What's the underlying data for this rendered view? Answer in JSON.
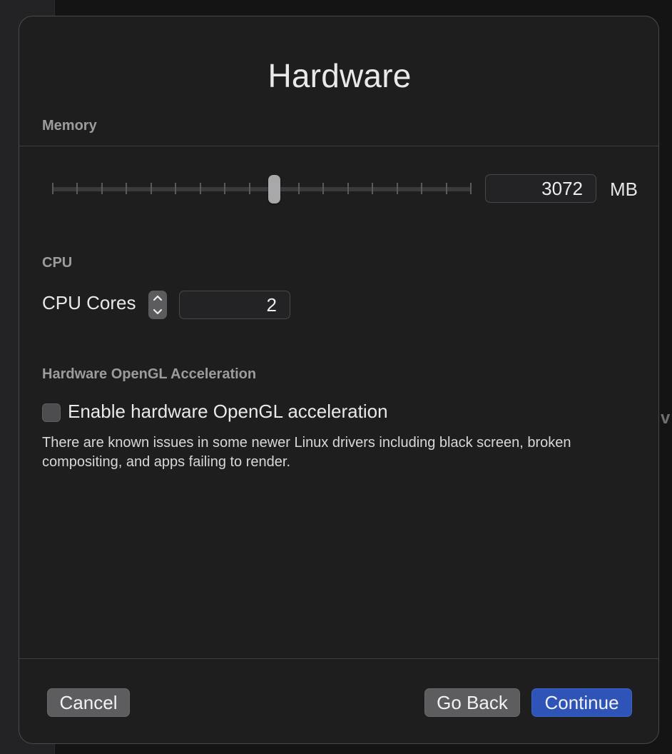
{
  "window": {
    "title": "Hardware"
  },
  "memory": {
    "section_label": "Memory",
    "value": "3072",
    "unit": "MB",
    "slider_tick_count": 18,
    "slider_position_fraction": 0.53
  },
  "cpu": {
    "section_label": "CPU",
    "cores_label": "CPU Cores",
    "cores_value": "2"
  },
  "opengl": {
    "section_label": "Hardware OpenGL Acceleration",
    "checkbox_label": "Enable hardware OpenGL acceleration",
    "checked": false,
    "note": "There are known issues in some newer Linux drivers including black screen, broken compositing, and apps failing to render."
  },
  "buttons": {
    "cancel": "Cancel",
    "go_back": "Go Back",
    "continue": "Continue"
  },
  "backdrop": {
    "partial_text": "v"
  },
  "colors": {
    "primary": "#2f54b8",
    "sheet_background": "#1e1e1e"
  }
}
